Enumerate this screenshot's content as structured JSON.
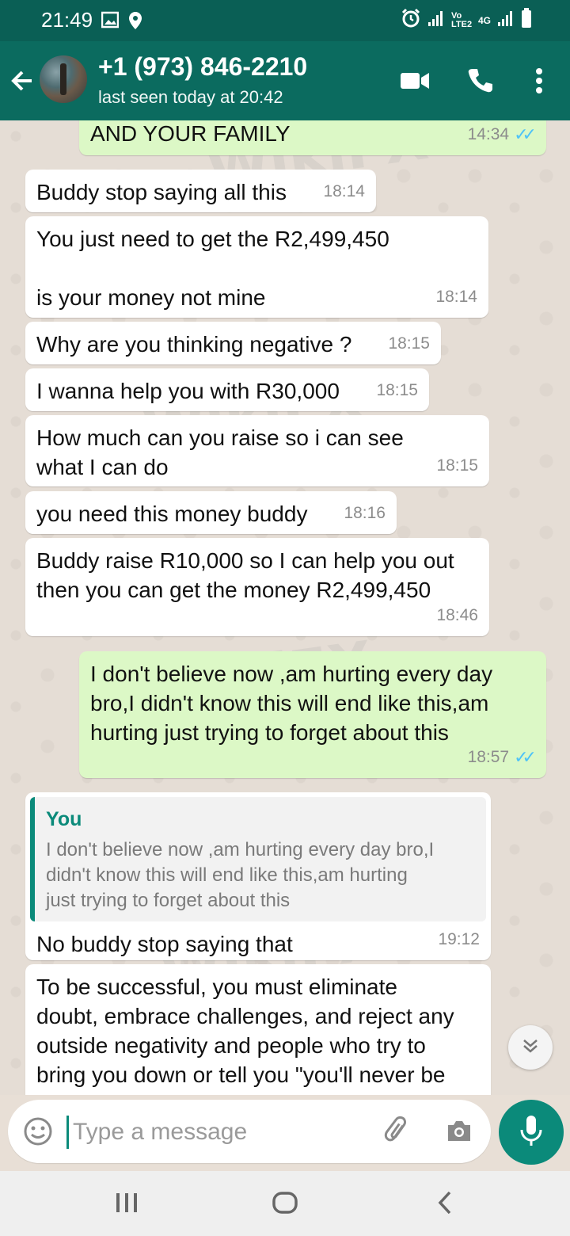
{
  "status_bar": {
    "time": "21:49",
    "network": "Vo LTE2",
    "network_type": "4G"
  },
  "header": {
    "contact_name": "+1 (973) 846-2210",
    "last_seen": "last seen today at 20:42"
  },
  "messages": [
    {
      "dir": "out",
      "text": "AND YOUR FAMILY",
      "time": "14:34"
    },
    {
      "dir": "in",
      "text": "Buddy stop saying all this",
      "time": "18:14"
    },
    {
      "dir": "in",
      "line1": "You just need to get the R2,499,450",
      "line2": "is your money not mine",
      "time": "18:14"
    },
    {
      "dir": "in",
      "text": "Why are you thinking negative ?",
      "time": "18:15"
    },
    {
      "dir": "in",
      "text": "I wanna help you with R30,000",
      "time": "18:15"
    },
    {
      "dir": "in",
      "line1": "How much can you raise so i can see",
      "line2": "what I can do",
      "time": "18:15"
    },
    {
      "dir": "in",
      "text": "you need this money buddy",
      "time": "18:16"
    },
    {
      "dir": "in",
      "line1": "Buddy raise R10,000 so I can help you out",
      "line2": "then you can get the money R2,499,450",
      "time": "18:46"
    },
    {
      "dir": "out",
      "line1": "I don't believe now ,am hurting every day",
      "line2": "bro,I didn't know this will end like this,am",
      "line3": "hurting just trying to forget about this",
      "time": "18:57"
    },
    {
      "dir": "in",
      "quote_author": "You",
      "quote_line1": "I don't believe now ,am hurting every day bro,I",
      "quote_line2": "didn't know this will end like this,am hurting",
      "quote_line3": "just trying to forget about this",
      "text": "No buddy stop saying that",
      "time": "19:12"
    },
    {
      "dir": "in",
      "line1": "To be successful, you must eliminate",
      "line2": "doubt, embrace challenges, and reject any",
      "line3": "outside negativity and people who try to",
      "line4": "bring you down or tell you \"you'll never be"
    }
  ],
  "watermark": "WikiFX",
  "input": {
    "placeholder": "Type a message"
  },
  "icons": {
    "status": [
      "image-icon",
      "location-icon",
      "alarm-icon",
      "signal-icon",
      "battery-icon"
    ],
    "header": [
      "back-arrow-icon",
      "video-call-icon",
      "phone-icon",
      "more-vert-icon"
    ],
    "input": [
      "emoji-icon",
      "attach-icon",
      "camera-icon",
      "mic-icon",
      "scroll-down-icon"
    ],
    "nav": [
      "recent-apps-icon",
      "home-icon",
      "back-icon"
    ]
  },
  "colors": {
    "header": "#0b6b5f",
    "status_bar": "#0a5f55",
    "outgoing_bubble": "#dcf8c6",
    "incoming_bubble": "#ffffff",
    "accent": "#0b8a7a",
    "read_tick": "#4fc3f7"
  }
}
